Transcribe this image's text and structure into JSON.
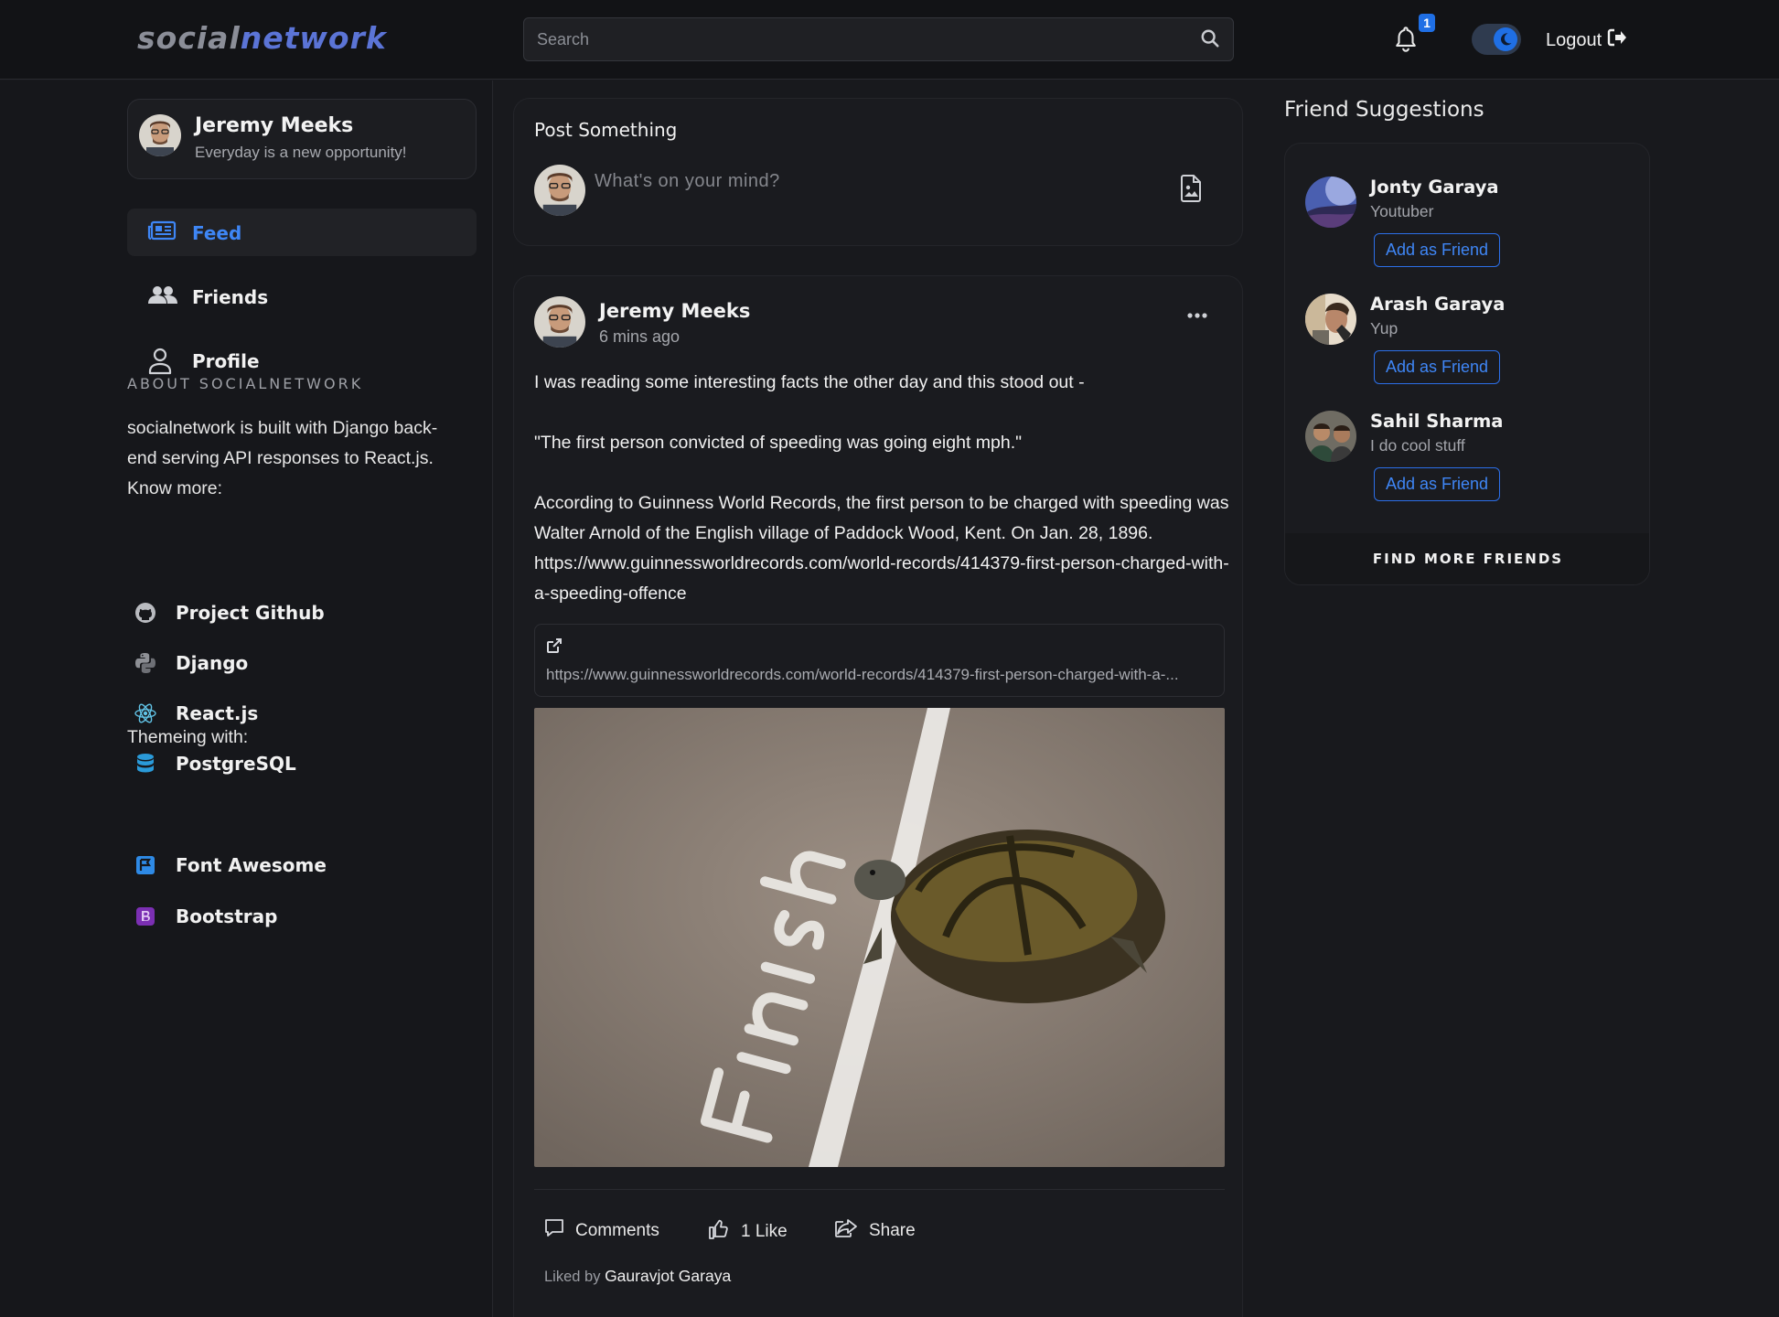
{
  "header": {
    "logo_part1": "social",
    "logo_part2": "network",
    "search_placeholder": "Search",
    "notification_count": "1",
    "logout_label": "Logout"
  },
  "profile": {
    "name": "Jeremy Meeks",
    "tagline": "Everyday is a new opportunity!"
  },
  "nav": {
    "feed": "Feed",
    "friends": "Friends",
    "profile": "Profile"
  },
  "about": {
    "heading": "ABOUT SOCIALNETWORK",
    "text": "socialnetwork is built with Django back-end serving API responses to React.js. Know more:",
    "links": [
      "Project Github",
      "Django",
      "React.js",
      "PostgreSQL"
    ],
    "theming_heading": "Themeing with:",
    "theming_links": [
      "Font Awesome",
      "Bootstrap"
    ]
  },
  "composer": {
    "title": "Post Something",
    "placeholder": "What's on your mind?"
  },
  "post": {
    "author": "Jeremy Meeks",
    "time": "6 mins ago",
    "body": "I was reading some interesting facts the other day and this stood out -\n\n\"The first person convicted of speeding was going eight mph.\"\n\nAccording to Guinness World Records, the first person to be charged with speeding was Walter Arnold of the English village of Paddock Wood, Kent. On Jan. 28, 1896. https://www.guinnessworldrecords.com/world-records/414379-first-person-charged-with-a-speeding-offence",
    "link_url": "https://www.guinnessworldrecords.com/world-records/414379-first-person-charged-with-a-...",
    "image_text": "Finish",
    "comments_label": "Comments",
    "likes_label": "1 Like",
    "share_label": "Share",
    "liked_by_prefix": "Liked by",
    "liked_by_name": "Gauravjot Garaya"
  },
  "suggestions": {
    "title": "Friend Suggestions",
    "items": [
      {
        "name": "Jonty Garaya",
        "subtitle": "Youtuber",
        "button": "Add as Friend"
      },
      {
        "name": "Arash Garaya",
        "subtitle": "Yup",
        "button": "Add as Friend"
      },
      {
        "name": "Sahil Sharma",
        "subtitle": "I do cool stuff",
        "button": "Add as Friend"
      }
    ],
    "footer": "FIND MORE FRIENDS"
  },
  "colors": {
    "accent": "#1f6fe5",
    "background": "#18191d",
    "card": "#1a1b1f"
  }
}
